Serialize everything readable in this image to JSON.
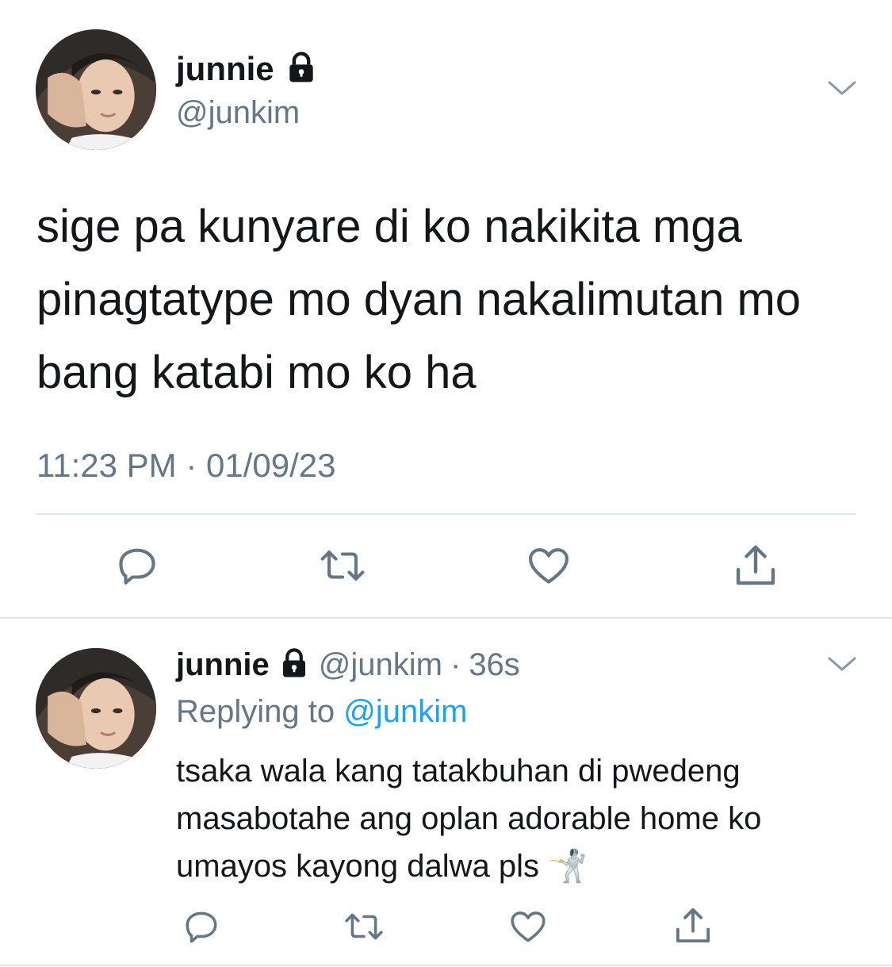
{
  "main_tweet": {
    "display_name": "junnie",
    "handle": "@junkim",
    "text_lines": [
      "sige pa kunyare di ko nakikita mga",
      "pinagtatype mo dyan nakalimutan mo",
      "bang katabi mo ko ha"
    ],
    "timestamp": "11:23 PM · 01/09/23",
    "actions": [
      "reply-icon",
      "retweet-icon",
      "like-icon",
      "share-icon"
    ]
  },
  "reply_tweet": {
    "display_name": "junnie",
    "handle": "@junkim",
    "separator": "·",
    "age": "36s",
    "replying_prefix": "Replying to",
    "replying_handle": "@junkim",
    "text_lines": [
      "tsaka wala kang tatakbuhan di pwedeng",
      "masabotahe ang oplan adorable home ko",
      "umayos kayong dalwa pls"
    ],
    "emoji": "🤺",
    "actions": [
      "reply-icon",
      "retweet-icon",
      "like-icon",
      "share-icon"
    ]
  },
  "colors": {
    "text": "#14171a",
    "secondary": "#657786",
    "link": "#1da1f2",
    "divider": "#e1e8ed",
    "icon": "#657786"
  }
}
